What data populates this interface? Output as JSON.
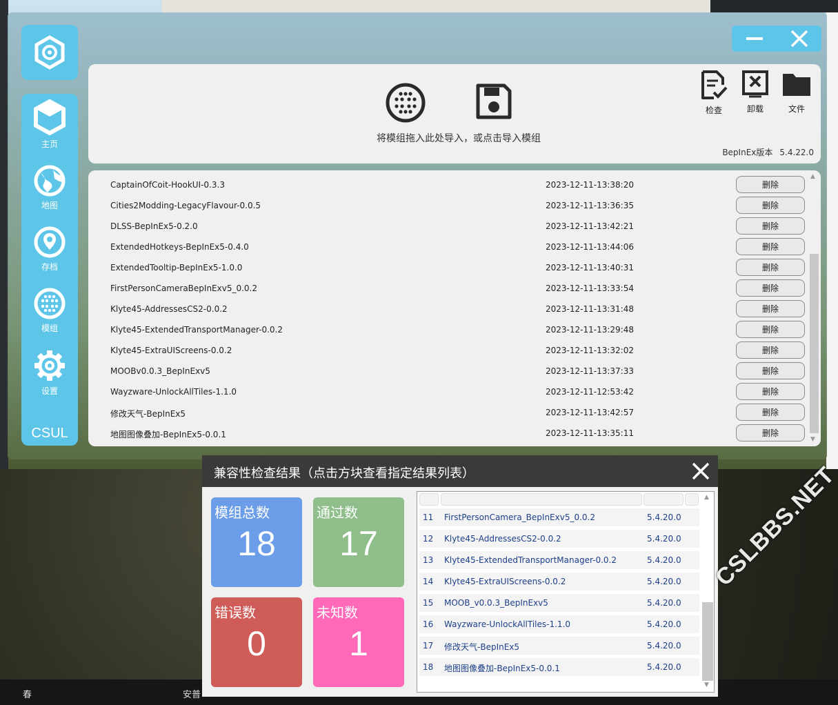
{
  "app": {
    "brand": "CSUL",
    "nav": [
      {
        "label": "主页",
        "icon": "cube-icon"
      },
      {
        "label": "地图",
        "icon": "globe-icon"
      },
      {
        "label": "存档",
        "icon": "location-pin-icon"
      },
      {
        "label": "模组",
        "icon": "dots-grid-icon"
      },
      {
        "label": "设置",
        "icon": "gear-icon"
      }
    ]
  },
  "import": {
    "drop_text": "将模组拖入此处导入，或点击导入模组",
    "tools": [
      {
        "label": "检查",
        "icon": "file-check-icon"
      },
      {
        "label": "卸载",
        "icon": "uninstall-icon"
      },
      {
        "label": "文件",
        "icon": "folder-icon"
      }
    ],
    "bepinex_label": "BepInEx版本",
    "bepinex_version": "5.4.22.0"
  },
  "mods": {
    "delete_label": "删除",
    "items": [
      {
        "name": "CaptainOfCoit-HookUI-0.3.3",
        "date": "2023-12-11-13:38:20"
      },
      {
        "name": "Cities2Modding-LegacyFlavour-0.0.5",
        "date": "2023-12-11-13:36:35"
      },
      {
        "name": "DLSS-BepInEx5-0.2.0",
        "date": "2023-12-11-13:42:21"
      },
      {
        "name": "ExtendedHotkeys-BepInEx5-0.4.0",
        "date": "2023-12-11-13:44:06"
      },
      {
        "name": "ExtendedTooltip-BepInEx5-1.0.0",
        "date": "2023-12-11-13:40:31"
      },
      {
        "name": "FirstPersonCameraBepInExv5_0.0.2",
        "date": "2023-12-11-13:33:54"
      },
      {
        "name": "Klyte45-AddressesCS2-0.0.2",
        "date": "2023-12-11-13:31:48"
      },
      {
        "name": "Klyte45-ExtendedTransportManager-0.0.2",
        "date": "2023-12-11-13:29:48"
      },
      {
        "name": "Klyte45-ExtraUIScreens-0.0.2",
        "date": "2023-12-11-13:32:02"
      },
      {
        "name": "MOOBv0.0.3_BepInExv5",
        "date": "2023-12-11-13:37:33"
      },
      {
        "name": "Wayzware-UnlockAllTiles-1.1.0",
        "date": "2023-12-11-12:53:42"
      },
      {
        "name": "修改天气-BepInEx5",
        "date": "2023-12-11-13:42:57"
      },
      {
        "name": "地图图像叠加-BepInEx5-0.0.1",
        "date": "2023-12-11-13:35:11"
      }
    ]
  },
  "dialog": {
    "title": "兼容性检查结果（点击方块查看指定结果列表）",
    "tiles": [
      {
        "label": "模组总数",
        "value": "18",
        "color": "#6b9de8"
      },
      {
        "label": "通过数",
        "value": "17",
        "color": "#8fbe8b"
      },
      {
        "label": "错误数",
        "value": "0",
        "color": "#cf5c58"
      },
      {
        "label": "未知数",
        "value": "1",
        "color": "#ff69b8"
      }
    ],
    "results": [
      {
        "n": "11",
        "name": "FirstPersonCamera_BepInExv5_0.0.2",
        "ver": "5.4.20.0"
      },
      {
        "n": "12",
        "name": "Klyte45-AddressesCS2-0.0.2",
        "ver": "5.4.20.0"
      },
      {
        "n": "13",
        "name": "Klyte45-ExtendedTransportManager-0.0.2",
        "ver": "5.4.20.0"
      },
      {
        "n": "14",
        "name": "Klyte45-ExtraUIScreens-0.0.2",
        "ver": "5.4.20.0"
      },
      {
        "n": "15",
        "name": "MOOB_v0.0.3_BepInExv5",
        "ver": "5.4.20.0"
      },
      {
        "n": "16",
        "name": "Wayzware-UnlockAllTiles-1.1.0",
        "ver": "5.4.20.0"
      },
      {
        "n": "17",
        "name": "修改天气-BepInEx5",
        "ver": "5.4.20.0"
      },
      {
        "n": "18",
        "name": "地图图像叠加-BepInEx5-0.0.1",
        "ver": "5.4.20.0"
      }
    ]
  },
  "background": {
    "watermark": "CSLBBS.NET",
    "season": "春",
    "place": "安普"
  }
}
